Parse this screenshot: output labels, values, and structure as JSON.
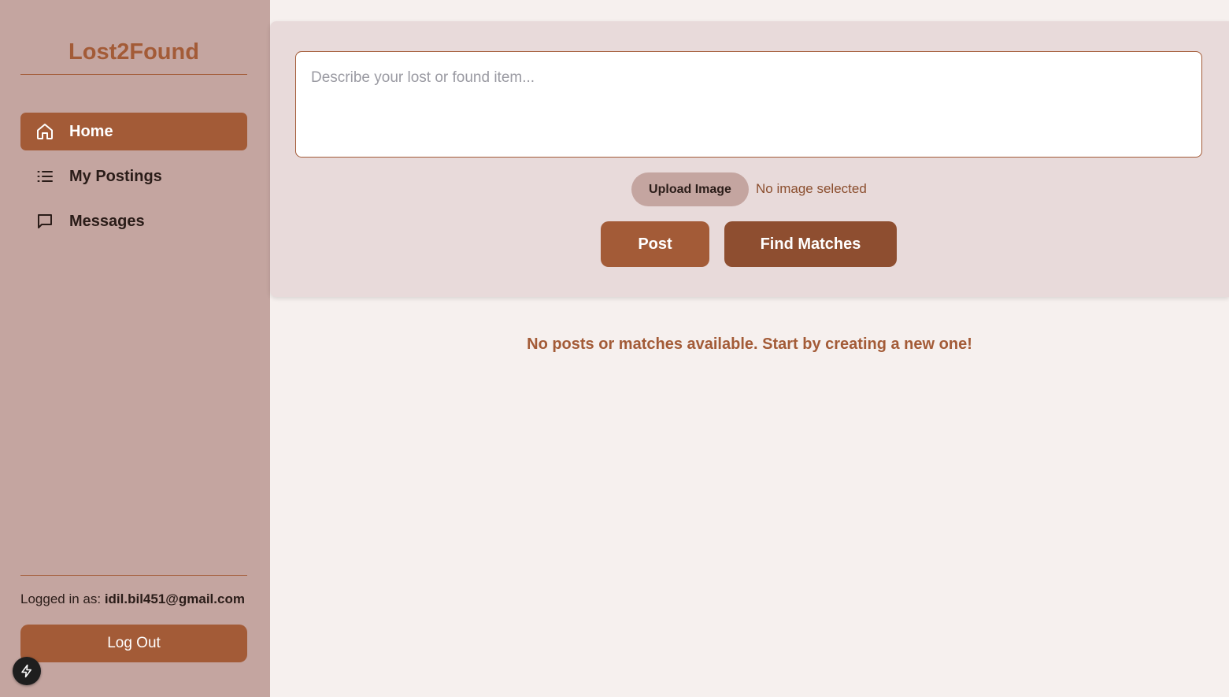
{
  "app": {
    "title": "Lost2Found"
  },
  "sidebar": {
    "items": [
      {
        "label": "Home",
        "icon": "home-icon",
        "active": true
      },
      {
        "label": "My Postings",
        "icon": "list-icon",
        "active": false
      },
      {
        "label": "Messages",
        "icon": "message-icon",
        "active": false
      }
    ],
    "logged_in_prefix": "Logged in as:",
    "user_email": "idil.bil451@gmail.com",
    "logout_label": "Log Out"
  },
  "composer": {
    "placeholder": "Describe your lost or found item...",
    "value": "",
    "upload_label": "Upload Image",
    "upload_status": "No image selected",
    "post_label": "Post",
    "find_matches_label": "Find Matches"
  },
  "feed": {
    "empty_message": "No posts or matches available. Start by creating a new one!"
  },
  "colors": {
    "sidebar_bg": "#c4a5a0",
    "accent": "#a35b37",
    "accent_dark": "#8e4e30",
    "panel_bg": "#e8dada",
    "page_bg": "#f6f0ee"
  }
}
